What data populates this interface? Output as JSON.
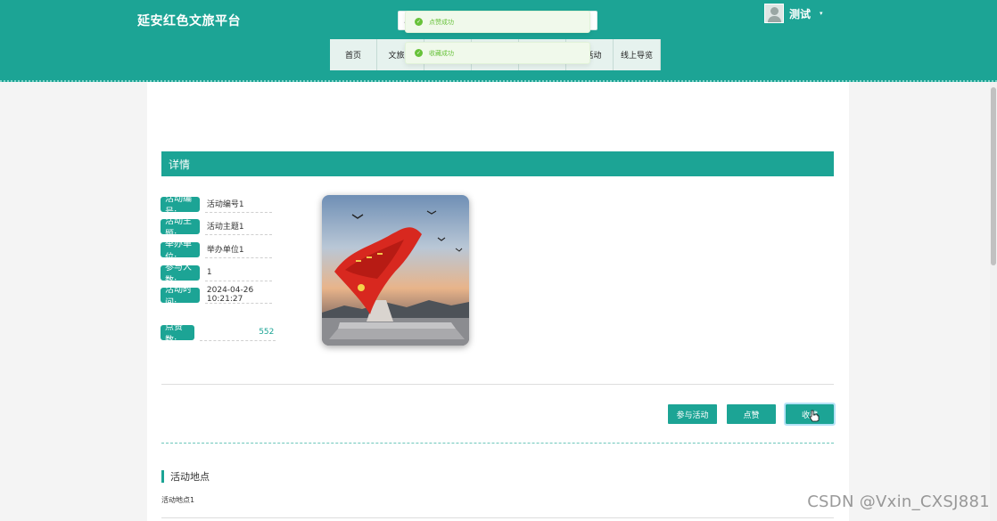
{
  "header": {
    "brand": "延安红色文旅平台",
    "search": {
      "placeholder": ""
    },
    "user": {
      "name": "测试",
      "caret": "▾"
    }
  },
  "nav": [
    {
      "label": "首页"
    },
    {
      "label": "文旅超"
    },
    {
      "label": ""
    },
    {
      "label": ""
    },
    {
      "label": ""
    },
    {
      "label": "红活动"
    },
    {
      "label": "线上导览"
    }
  ],
  "toasts": [
    {
      "text": "点赞成功",
      "icon": "check-circle-icon"
    },
    {
      "text": "收藏成功",
      "icon": "check-circle-icon"
    }
  ],
  "detail": {
    "section_title": "详情",
    "fields": [
      {
        "label": "活动编号:",
        "value": "活动编号1"
      },
      {
        "label": "活动主题:",
        "value": "活动主题1"
      },
      {
        "label": "举办单位:",
        "value": "举办单位1"
      },
      {
        "label": "参与人数:",
        "value": "1"
      },
      {
        "label": "活动时间:",
        "value": "2024-04-26 10:21:27"
      }
    ],
    "likes": {
      "label": "点赞数:",
      "value": "552"
    },
    "photo": {
      "icon": "red-flag-monument-image"
    }
  },
  "actions": {
    "join": "参与活动",
    "like": "点赞",
    "favorite": "收藏"
  },
  "location": {
    "title": "活动地点",
    "text": "活动地点1"
  },
  "watermark": "CSDN @Vxin_CXSJ881",
  "colors": {
    "primary": "#1ca495",
    "toast_bg": "#f0f9eb",
    "toast_text": "#67c23a"
  }
}
